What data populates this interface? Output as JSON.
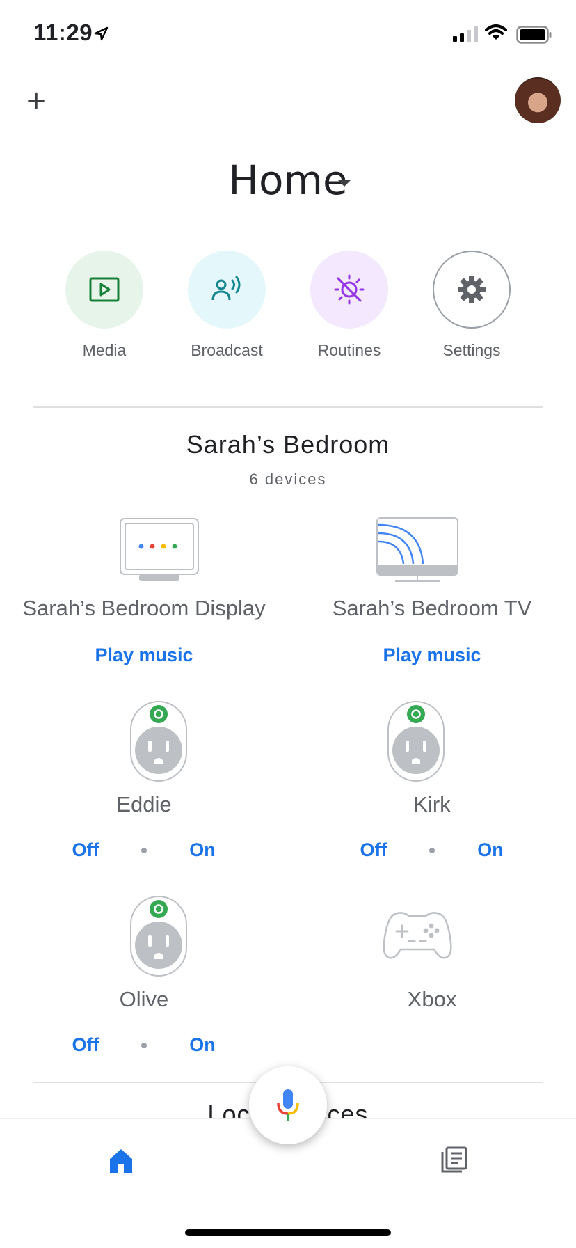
{
  "status_bar": {
    "time": "11:29"
  },
  "header": {
    "title": "Home"
  },
  "quick_actions": [
    {
      "label": "Media",
      "icon": "media-play-icon",
      "bg": "#e6f4ea",
      "fg": "#188038"
    },
    {
      "label": "Broadcast",
      "icon": "broadcast-icon",
      "bg": "#e4f7fb",
      "fg": "#12858f"
    },
    {
      "label": "Routines",
      "icon": "routines-icon",
      "bg": "#f3e8fd",
      "fg": "#9334e6"
    },
    {
      "label": "Settings",
      "icon": "gear-icon",
      "bg": "#ffffff",
      "fg": "#5f6368"
    }
  ],
  "room": {
    "name": "Sarah’s Bedroom",
    "subtitle": "6 devices",
    "devices": [
      {
        "name": "Sarah’s Bedroom Display",
        "action": "Play music",
        "icon": "smart-display-icon"
      },
      {
        "name": "Sarah’s Bedroom TV",
        "action": "Play music",
        "icon": "cast-tv-icon"
      },
      {
        "name": "Eddie",
        "off": "Off",
        "on": "On",
        "icon": "smart-plug-icon"
      },
      {
        "name": "Kirk",
        "off": "Off",
        "on": "On",
        "icon": "smart-plug-icon"
      },
      {
        "name": "Olive",
        "off": "Off",
        "on": "On",
        "icon": "smart-plug-icon"
      },
      {
        "name": "Xbox",
        "icon": "gamepad-icon"
      }
    ]
  },
  "next_section_peek": "Local devices",
  "colors": {
    "accent": "#1a73e8",
    "plug_status": "#34a853"
  },
  "bottom_nav": [
    {
      "icon": "home-icon",
      "active": true
    },
    {
      "icon": "feed-icon",
      "active": false
    }
  ]
}
